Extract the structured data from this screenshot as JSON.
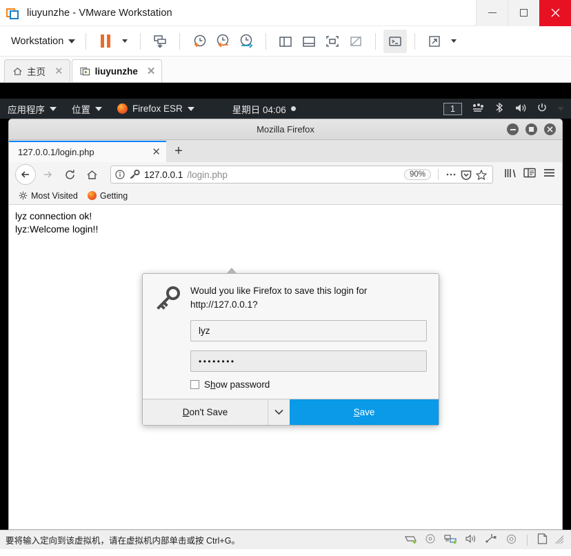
{
  "vmware": {
    "title": "liuyunzhe - VMware Workstation",
    "app_icon": "vmware-logo-icon",
    "window_controls": {
      "minimize": "minimize-icon",
      "maximize": "maximize-icon",
      "close": "close-icon"
    },
    "toolbar": {
      "workstation_label": "Workstation",
      "buttons": [
        "pause-vm-button",
        "pause-dropdown-button",
        "send-ctrl-alt-del-button",
        "snapshot-take-button",
        "snapshot-revert-button",
        "snapshot-manager-button",
        "show-left-pane-button",
        "show-bottom-pane-button",
        "fullscreen-button",
        "unity-mode-button",
        "console-view-button",
        "expand-button"
      ]
    },
    "tabs": [
      {
        "label": "主页",
        "icon": "home-icon",
        "selected": false,
        "close": "✕"
      },
      {
        "label": "liuyunzhe",
        "icon": "vm-play-icon",
        "selected": true,
        "close": "✕"
      }
    ],
    "statusbar": {
      "message": "要将输入定向到该虚拟机，请在虚拟机内部单击或按 Ctrl+G。",
      "devices": [
        "hard-disk-icon",
        "cd-dvd-icon",
        "network-adapter-icon",
        "sound-card-icon",
        "usb-device-icon",
        "printer-icon",
        "display-icon"
      ]
    }
  },
  "guest": {
    "gnome_panel": {
      "applications": "应用程序",
      "places": "位置",
      "firefox": "Firefox ESR",
      "clock": "星期日 04:06",
      "workspace": "1",
      "tray_icons": [
        "network-icon",
        "bluetooth-icon",
        "volume-icon",
        "power-icon"
      ]
    },
    "firefox": {
      "window_title": "Mozilla Firefox",
      "window_controls": {
        "minimize": "minimize-icon",
        "maximize": "maximize-icon",
        "close": "close-icon"
      },
      "tab": {
        "title": "127.0.0.1/login.php",
        "close_label": "✕",
        "new_tab_label": "+"
      },
      "navigation": {
        "back": "back-arrow-icon",
        "forward": "forward-arrow-icon",
        "reload": "reload-icon",
        "home": "home-icon"
      },
      "urlbar": {
        "info_icon": "page-info-icon",
        "key_icon": "saved-login-key-icon",
        "host": "127.0.0.1",
        "path": "/login.php",
        "zoom_level": "90%",
        "page_actions": "ellipsis-icon",
        "pocket": "pocket-icon",
        "bookmark_star": "star-icon"
      },
      "toolbar_right": {
        "library": "library-icon",
        "sidebar": "sidebar-icon",
        "menu": "hamburger-menu-icon"
      },
      "bookmarks": [
        {
          "label": "Most Visited",
          "icon": "gear-icon"
        },
        {
          "label": "Getting",
          "icon": "firefox-icon"
        }
      ],
      "page_content": [
        "lyz connection ok!",
        "lyz:Welcome login!!"
      ],
      "doorhanger": {
        "icon": "key-icon",
        "message_line1": "Would you like Firefox to save this login for",
        "message_line2": "http://127.0.0.1?",
        "username_value": "lyz",
        "password_value": "••••••••",
        "show_password_label": "Show password",
        "show_password_checked": false,
        "dont_save_label": "Don't Save",
        "dropdown_icon": "chevron-down-icon",
        "save_label": "Save"
      }
    }
  },
  "colors": {
    "accent_blue": "#0a9ae8",
    "vmware_orange": "#ec6a28",
    "close_red": "#e81123",
    "panel_dark": "#21262b",
    "tab_active_blue": "#0a84ff"
  }
}
